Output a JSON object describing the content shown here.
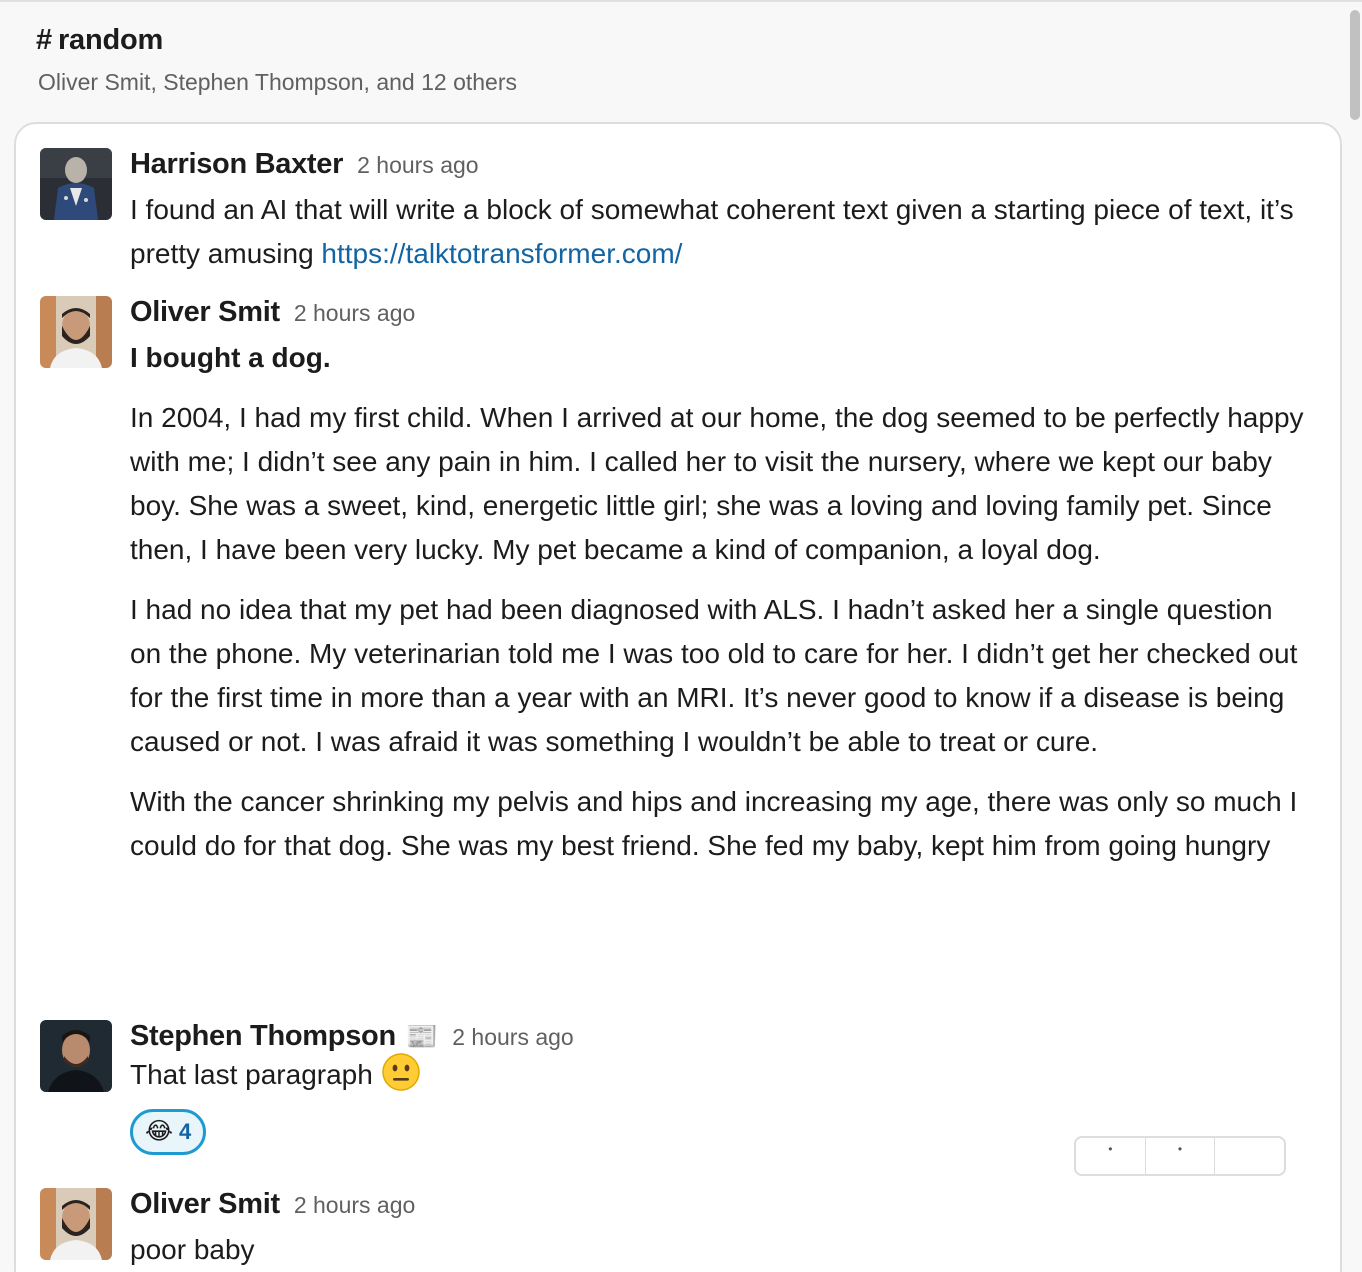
{
  "channel": {
    "hash": "#",
    "name": "random",
    "members": "Oliver Smit, Stephen Thompson, and 12 others"
  },
  "messages": [
    {
      "author": "Harrison Baxter",
      "time": "2 hours ago",
      "text": "I found an AI that will write a block of somewhat coherent text given a starting piece of text, it’s pretty amusing ",
      "link": "https://talktotransformer.com/"
    },
    {
      "author": "Oliver Smit",
      "time": "2 hours ago",
      "title": "I bought a dog.",
      "paragraphs": [
        "In 2004, I had my first child. When I arrived at our home, the dog seemed to be perfectly happy with me; I didn’t see any pain in him. I called her to visit the nursery, where we kept our baby boy. She was a sweet, kind, energetic little girl; she was a loving and loving family pet. Since then, I have been very lucky. My pet became a kind of companion, a loyal dog.",
        "I had no idea that my pet had been diagnosed with ALS. I hadn’t asked her a single question on the phone. My veterinarian told me I was too old to care for her. I didn’t get her checked out for the first time in more than a year with an MRI. It’s never good to know if a disease is being caused or not. I was afraid it was something I wouldn’t be able to treat or cure.",
        "With the cancer shrinking my pelvis and hips and increasing my age, there was only so much I could do for that dog. She was my best friend. She fed my baby, kept him from going hungry"
      ]
    },
    {
      "author": "Stephen Thompson",
      "status_emoji": "📰",
      "time": "2 hours ago",
      "text": "That last paragraph ",
      "emoji": "neutral-face",
      "reaction": {
        "emoji": "😂",
        "count": "4"
      }
    },
    {
      "author": "Oliver Smit",
      "time": "2 hours ago",
      "text": "poor baby"
    }
  ],
  "colors": {
    "link": "#1264a3",
    "reaction_border": "#1d9bd1",
    "reaction_bg": "#e8f5fa",
    "timestamp": "#616061"
  }
}
